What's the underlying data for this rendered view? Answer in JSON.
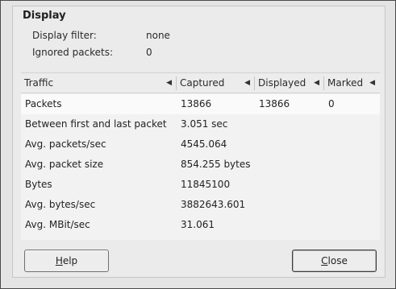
{
  "section_title": "Display",
  "summary": {
    "display_filter_label": "Display filter:",
    "display_filter_value": "none",
    "ignored_packets_label": "Ignored packets:",
    "ignored_packets_value": "0"
  },
  "table": {
    "columns": [
      {
        "label": "Traffic",
        "sort_icon": "triangle-left-icon"
      },
      {
        "label": "Captured",
        "sort_icon": "triangle-left-icon"
      },
      {
        "label": "Displayed",
        "sort_icon": "triangle-left-icon"
      },
      {
        "label": "Marked",
        "sort_icon": "triangle-left-icon"
      }
    ],
    "rows": [
      {
        "traffic": "Packets",
        "captured": "13866",
        "displayed": "13866",
        "marked": "0"
      },
      {
        "traffic": "Between first and last packet",
        "captured": "3.051 sec",
        "displayed": "",
        "marked": ""
      },
      {
        "traffic": "Avg. packets/sec",
        "captured": "4545.064",
        "displayed": "",
        "marked": ""
      },
      {
        "traffic": "Avg. packet size",
        "captured": "854.255 bytes",
        "displayed": "",
        "marked": ""
      },
      {
        "traffic": "Bytes",
        "captured": "11845100",
        "displayed": "",
        "marked": ""
      },
      {
        "traffic": "Avg. bytes/sec",
        "captured": "3882643.601",
        "displayed": "",
        "marked": ""
      },
      {
        "traffic": "Avg. MBit/sec",
        "captured": "31.061",
        "displayed": "",
        "marked": ""
      }
    ]
  },
  "buttons": {
    "help": {
      "mnemonic": "H",
      "rest": "elp"
    },
    "close": {
      "mnemonic": "C",
      "rest": "lose"
    }
  }
}
